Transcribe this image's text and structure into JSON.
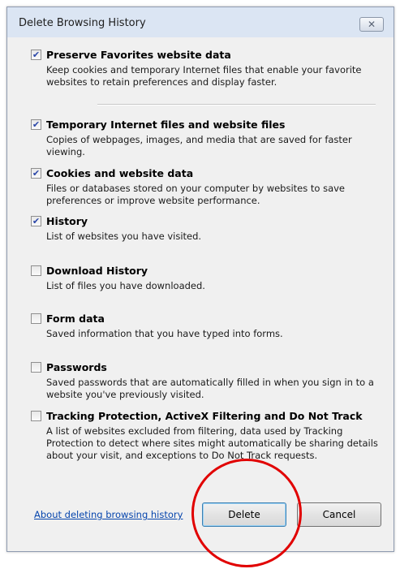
{
  "window": {
    "title": "Delete Browsing History",
    "close_glyph": "✕"
  },
  "items": [
    {
      "checked": true,
      "label": "Preserve Favorites website data",
      "desc": "Keep cookies and temporary Internet files that enable your favorite websites to retain preferences and display faster."
    },
    {
      "checked": true,
      "label": "Temporary Internet files and website files",
      "desc": "Copies of webpages, images, and media that are saved for faster viewing."
    },
    {
      "checked": true,
      "label": "Cookies and website data",
      "desc": "Files or databases stored on your computer by websites to save preferences or improve website performance."
    },
    {
      "checked": true,
      "label": "History",
      "desc": "List of websites you have visited."
    },
    {
      "checked": false,
      "label": "Download History",
      "desc": "List of files you have downloaded."
    },
    {
      "checked": false,
      "label": "Form data",
      "desc": "Saved information that you have typed into forms."
    },
    {
      "checked": false,
      "label": "Passwords",
      "desc": "Saved passwords that are automatically filled in when you sign in to a website you've previously visited."
    },
    {
      "checked": false,
      "label": "Tracking Protection, ActiveX Filtering and Do Not Track",
      "desc": "A list of websites excluded from filtering, data used by Tracking Protection to detect where sites might automatically be sharing details about your visit, and exceptions to Do Not Track requests."
    }
  ],
  "footer": {
    "help_link": "About deleting browsing history",
    "delete_label": "Delete",
    "cancel_label": "Cancel"
  },
  "colors": {
    "annotation": "#e10000",
    "link": "#0645ad",
    "check": "#2a46a8"
  }
}
